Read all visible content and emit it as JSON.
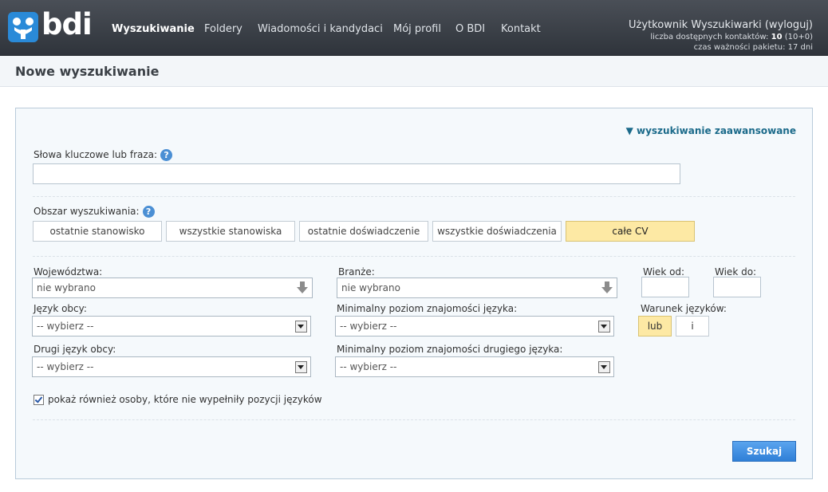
{
  "header": {
    "logo_text": "bdi",
    "nav": [
      {
        "label": "Wyszukiwanie",
        "active": true
      },
      {
        "label": "Foldery"
      },
      {
        "label": "Wiadomości i kandydaci"
      },
      {
        "label": "Mój profil"
      },
      {
        "label": "O BDI"
      },
      {
        "label": "Kontakt"
      }
    ],
    "user": {
      "name": "Użytkownik Wyszukiwarki",
      "logout_label": "(wyloguj)",
      "contacts_label": "liczba dostępnych kontaktów:",
      "contacts_value": "10",
      "contacts_detail": "(10+0)",
      "validity_label": "czas ważności pakietu:",
      "validity_value": "17 dni"
    }
  },
  "page_title": "Nowe wyszukiwanie",
  "form": {
    "advanced_link": "▼ wyszukiwanie zaawansowane",
    "keywords": {
      "label": "Słowa kluczowe lub fraza:",
      "value": ""
    },
    "help_glyph": "?",
    "area": {
      "label": "Obszar wyszukiwania:",
      "options": [
        "ostatnie stanowisko",
        "wszystkie stanowiska",
        "ostatnie doświadczenie",
        "wszystkie doświadczenia",
        "całe CV"
      ],
      "selected": 4
    },
    "voivodeships": {
      "label": "Województwa:",
      "value": "nie wybrano"
    },
    "industries": {
      "label": "Branże:",
      "value": "nie wybrano"
    },
    "age_from": {
      "label": "Wiek od:",
      "value": ""
    },
    "age_to": {
      "label": "Wiek do:",
      "value": ""
    },
    "language": {
      "label": "Język obcy:",
      "value": "-- wybierz --"
    },
    "min_level": {
      "label": "Minimalny poziom znajomości języka:",
      "value": "-- wybierz --"
    },
    "lang_condition": {
      "label": "Warunek języków:",
      "options": [
        "lub",
        "i"
      ],
      "selected": 0
    },
    "second_language": {
      "label": "Drugi język obcy:",
      "value": "-- wybierz --"
    },
    "second_min_level": {
      "label": "Minimalny poziom znajomości drugiego języka:",
      "value": "-- wybierz --"
    },
    "show_incomplete": {
      "label": "pokaż również osoby, które nie wypełniły pozycji języków",
      "checked": true
    },
    "search_button": "Szukaj"
  },
  "colors": {
    "accent": "#2f7fd7",
    "selected": "#fde9a4",
    "header": "#2f343b",
    "link": "#1b6a8a"
  }
}
